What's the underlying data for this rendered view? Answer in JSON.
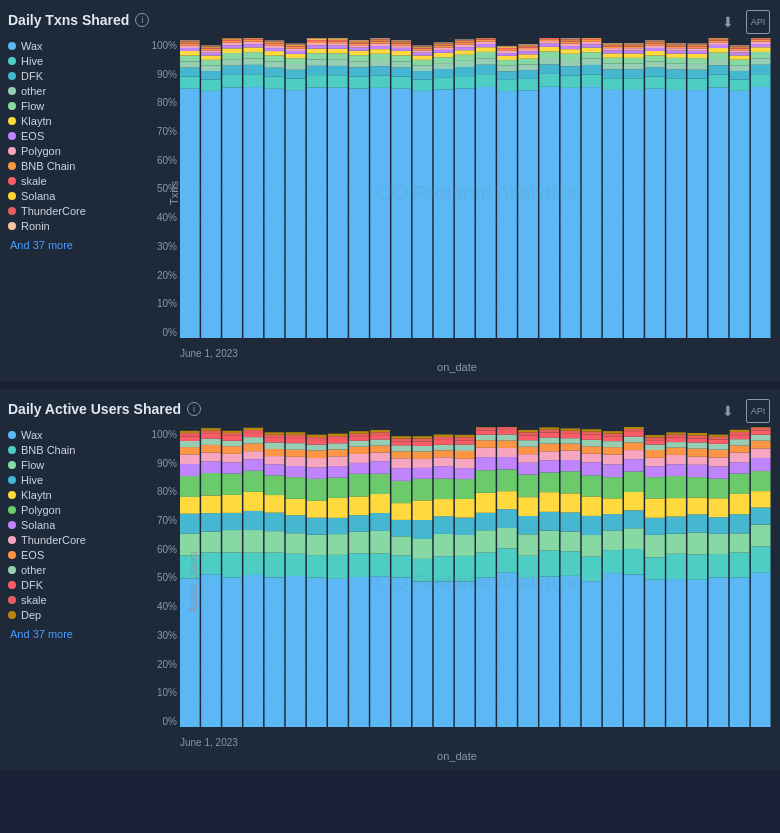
{
  "chart1": {
    "title": "Daily Txns Shared",
    "yAxisTitle": "Txns",
    "xAxisTitle": "on_date",
    "xStartLabel": "June 1, 2023",
    "watermark": "⬡⬡ Footprint Analytics",
    "andMore": "And 37 more",
    "yLabels": [
      "100%",
      "90%",
      "80%",
      "70%",
      "60%",
      "50%",
      "40%",
      "30%",
      "20%",
      "10%",
      "0%"
    ],
    "legend": [
      {
        "label": "Wax",
        "color": "#5bb8f5"
      },
      {
        "label": "Hive",
        "color": "#4ecdc4"
      },
      {
        "label": "DFK",
        "color": "#45b7d1"
      },
      {
        "label": "other",
        "color": "#96ceb4"
      },
      {
        "label": "Flow",
        "color": "#88d8a3"
      },
      {
        "label": "Klaytn",
        "color": "#ffd93d"
      },
      {
        "label": "EOS",
        "color": "#c084fc"
      },
      {
        "label": "Polygon",
        "color": "#f8a5c2"
      },
      {
        "label": "BNB Chain",
        "color": "#fd9644"
      },
      {
        "label": "skale",
        "color": "#fc5c65"
      },
      {
        "label": "Solana",
        "color": "#fed330"
      },
      {
        "label": "ThunderCore",
        "color": "#e85d5d"
      },
      {
        "label": "Ronin",
        "color": "#f7c59f"
      }
    ]
  },
  "chart2": {
    "title": "Daily Active Users Shared",
    "yAxisTitle": "Active Users",
    "xAxisTitle": "on_date",
    "xStartLabel": "June 1, 2023",
    "watermark": "⬡⬡ Footprint Analytics",
    "andMore": "And 37 more",
    "yLabels": [
      "100%",
      "90%",
      "80%",
      "70%",
      "60%",
      "50%",
      "40%",
      "30%",
      "20%",
      "10%",
      "0%"
    ],
    "legend": [
      {
        "label": "Wax",
        "color": "#5bb8f5"
      },
      {
        "label": "BNB Chain",
        "color": "#4ecdc4"
      },
      {
        "label": "Flow",
        "color": "#88d8a3"
      },
      {
        "label": "Hive",
        "color": "#45b7d1"
      },
      {
        "label": "Klaytn",
        "color": "#ffd93d"
      },
      {
        "label": "Polygon",
        "color": "#6bcb6b"
      },
      {
        "label": "Solana",
        "color": "#c084fc"
      },
      {
        "label": "ThunderCore",
        "color": "#f8a5c2"
      },
      {
        "label": "EOS",
        "color": "#fd9644"
      },
      {
        "label": "other",
        "color": "#96ceb4"
      },
      {
        "label": "DFK",
        "color": "#fc5c65"
      },
      {
        "label": "skale",
        "color": "#e85d5d"
      },
      {
        "label": "Dep",
        "color": "#b8860b"
      }
    ]
  },
  "icons": {
    "download": "⬇",
    "api": "API",
    "info": "i"
  }
}
